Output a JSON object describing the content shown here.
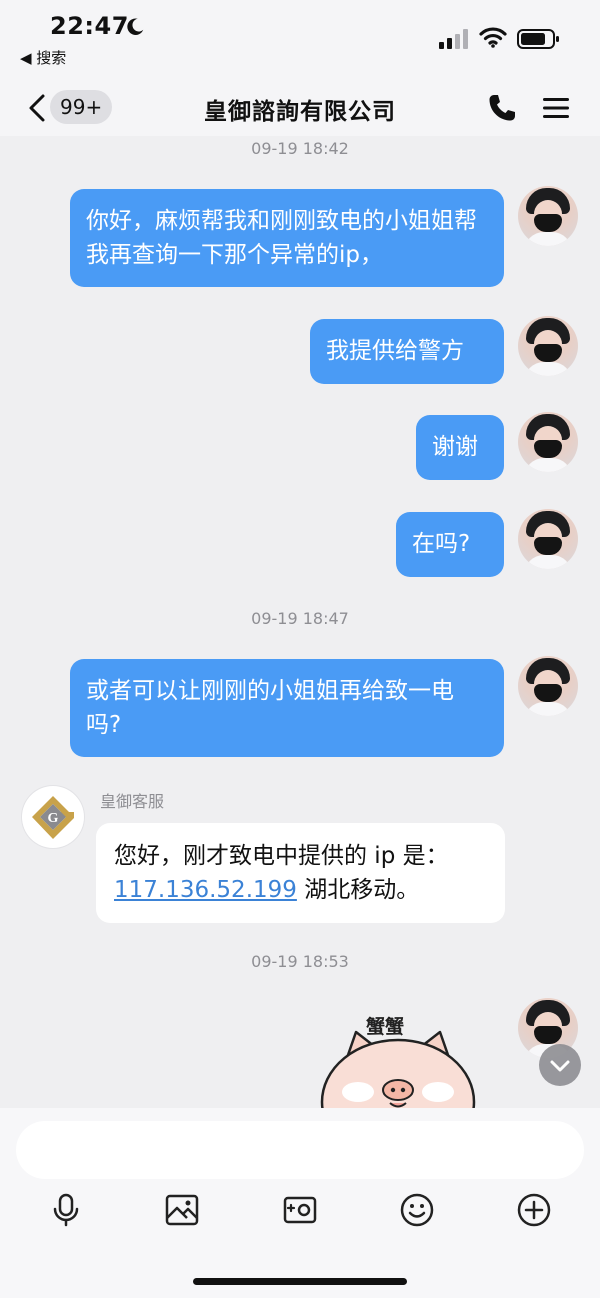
{
  "status_bar": {
    "time": "22:47",
    "back_label": "◀ 搜索"
  },
  "nav": {
    "unread_count": "99+",
    "title": "皇御諮詢有限公司"
  },
  "messages": {
    "ts1": "09-19 18:42",
    "m1": "你好，麻烦帮我和刚刚致电的小姐姐帮我再查询一下那个异常的ip，",
    "m2": "我提供给警方",
    "m3": "谢谢",
    "m4": "在吗?",
    "ts2": "09-19 18:47",
    "m5": "或者可以让刚刚的小姐姐再给致一电吗?",
    "sender_name": "皇御客服",
    "reply_prefix": "您好，刚才致电中提供的 ip 是：",
    "reply_ip": "117.136.52.199",
    "reply_suffix": " 湖北移动。",
    "ts3": "09-19 18:53",
    "sticker_text": "蟹蟹"
  },
  "input": {
    "placeholder": ""
  },
  "colors": {
    "accent": "#4a9bf5",
    "background": "#efeff1",
    "link": "#3b82d6"
  },
  "icons": [
    "moon-icon",
    "signal-icon",
    "wifi-icon",
    "battery-icon",
    "back-chevron-icon",
    "phone-icon",
    "menu-icon",
    "chevron-down-icon",
    "microphone-icon",
    "image-icon",
    "camera-icon",
    "emoji-icon",
    "plus-icon"
  ]
}
